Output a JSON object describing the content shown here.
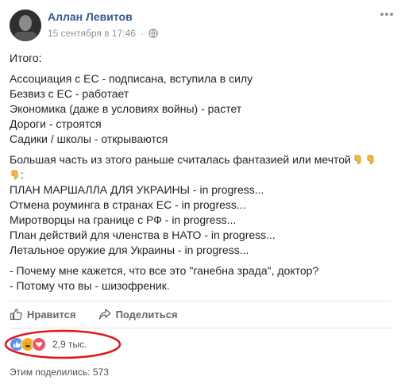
{
  "post": {
    "author": "Аллан Левитов",
    "date": "15 сентября в 17:46",
    "separator": "·",
    "intro": "Итого:",
    "list1": [
      "Ассоциация с ЕС - подписана, вступила в силу",
      "Безвиз с ЕС - работает",
      "Экономика (даже в условиях войны) - растет",
      "Дороги - строятся",
      "Садики / школы - открываются"
    ],
    "fantasy_line": "Большая часть из этого раньше считалась фантазией или мечтой",
    "colon": ":",
    "list2": [
      "ПЛАН МАРШАЛЛА ДЛЯ УКРАИНЫ - in progress...",
      "Отмена роуминга в странах ЕС - in progress...",
      "Миротворцы на границе с РФ - in progress...",
      "План действий для членства в НАТО - in progress...",
      "Летальное оружие для Украины - in progress..."
    ],
    "dialog": [
      "- Почему мне кажется, что все это \"ганебна зрада\", доктор?",
      "- Потому что вы - шизофреник."
    ]
  },
  "actions": {
    "like_label": "Нравится",
    "share_label": "Поделиться"
  },
  "reactions": {
    "count": "2,9 тыс."
  },
  "shares": {
    "text": "Этим поделились: 573"
  },
  "colors": {
    "link": "#365899",
    "muted": "#90949c",
    "like_blue": "#5890ff",
    "haha_yellow": "#f7b125",
    "love_red": "#f25268",
    "annotation_red": "#e0161d"
  }
}
